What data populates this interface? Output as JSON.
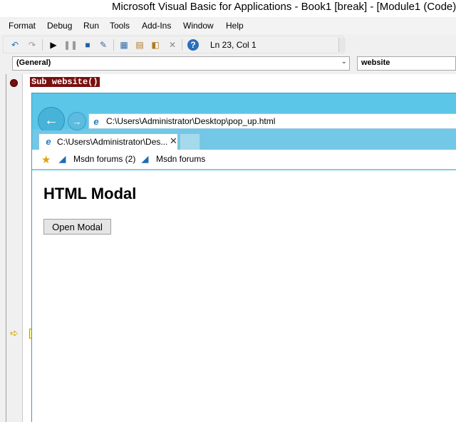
{
  "window": {
    "title": "Microsoft Visual Basic for Applications - Book1 [break] - [Module1 (Code)]"
  },
  "menu": {
    "items": [
      "Format",
      "Debug",
      "Run",
      "Tools",
      "Add-Ins",
      "Window",
      "Help"
    ]
  },
  "toolbar": {
    "icons": [
      "undo-icon",
      "redo-icon",
      "run-icon",
      "break-icon",
      "reset-icon",
      "design-mode-icon",
      "project-explorer-icon",
      "properties-icon",
      "object-browser-icon",
      "toolbox-icon",
      "help-icon"
    ],
    "status": "Ln 23, Col 1"
  },
  "combos": {
    "object": "(General)",
    "procedure": "website"
  },
  "code": {
    "breakpoint_line": "Sub website()"
  },
  "ie": {
    "address": "C:\\Users\\Administrator\\Desktop\\pop_up.html",
    "tab_title": "C:\\Users\\Administrator\\Des...",
    "favorites": [
      "Msdn forums (2)",
      "Msdn forums"
    ],
    "page": {
      "heading": "HTML Modal",
      "button": "Open Modal"
    }
  }
}
